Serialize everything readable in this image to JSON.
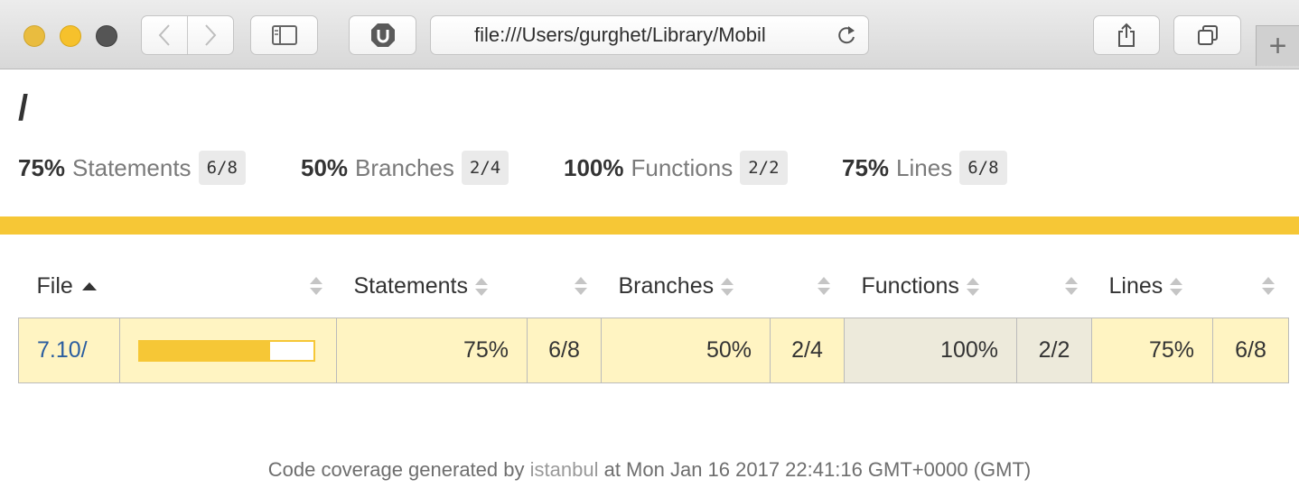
{
  "browser": {
    "address": "file:///Users/gurghet/Library/Mobil",
    "new_tab_label": "+"
  },
  "page": {
    "title": "/"
  },
  "summary": [
    {
      "pct": "75%",
      "label": "Statements",
      "fraction": "6/8"
    },
    {
      "pct": "50%",
      "label": "Branches",
      "fraction": "2/4"
    },
    {
      "pct": "100%",
      "label": "Functions",
      "fraction": "2/2"
    },
    {
      "pct": "75%",
      "label": "Lines",
      "fraction": "6/8"
    }
  ],
  "table": {
    "headers": {
      "file": "File",
      "statements": "Statements",
      "branches": "Branches",
      "functions": "Functions",
      "lines": "Lines"
    },
    "rows": [
      {
        "file": "7.10/",
        "coverage_fraction": 0.75,
        "statements_pct": "75%",
        "statements_frac": "6/8",
        "branches_pct": "50%",
        "branches_frac": "2/4",
        "functions_pct": "100%",
        "functions_frac": "2/2",
        "lines_pct": "75%",
        "lines_frac": "6/8"
      }
    ]
  },
  "footer": {
    "prefix": "Code coverage generated by",
    "link": "istanbul",
    "suffix": "at Mon Jan 16 2017 22:41:16 GMT+0000 (GMT)"
  },
  "colors": {
    "accent": "#f6c736",
    "row_medium": "#fff4c2",
    "row_high": "#edeadb",
    "link": "#2a5d9f"
  }
}
